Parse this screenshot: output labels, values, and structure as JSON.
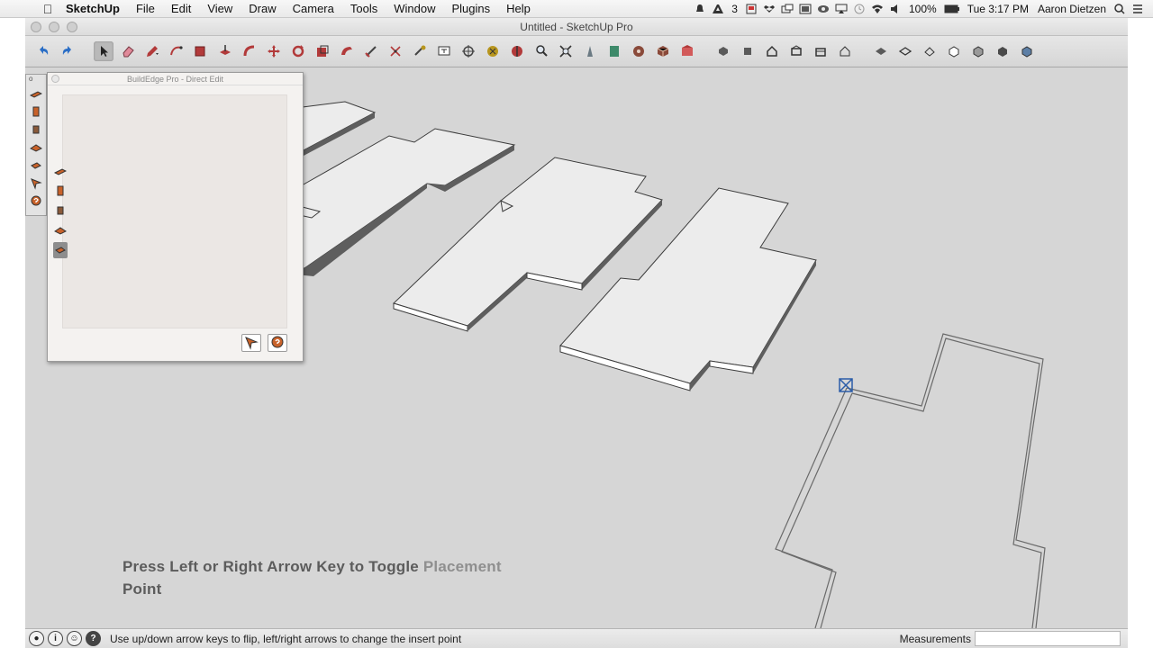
{
  "menubar": {
    "apple": "",
    "items": [
      "SketchUp",
      "File",
      "Edit",
      "View",
      "Draw",
      "Camera",
      "Tools",
      "Window",
      "Plugins",
      "Help"
    ],
    "adobe_count": "3",
    "battery": "100%",
    "clock": "Tue 3:17 PM",
    "user": "Aaron Dietzen"
  },
  "window": {
    "title": "Untitled - SketchUp Pro"
  },
  "panel": {
    "title": "BuildEdge Pro - Direct Edit"
  },
  "vtoolbar": {
    "header": "o"
  },
  "hint": {
    "line1_dark": "Press Left or Right Arrow Key to Toggle",
    "line1_light": " Placement",
    "line2": "Point"
  },
  "statusbar": {
    "message": "Use up/down arrow keys to flip, left/right arrows to change the insert point",
    "measurements_label": "Measurements",
    "measurements_value": ""
  },
  "colors": {
    "accent_red": "#b23a3a",
    "tool_orange": "#c8622a",
    "canvas": "#d6d6d6",
    "face": "#ececec",
    "edge": "#3c3c3c"
  }
}
